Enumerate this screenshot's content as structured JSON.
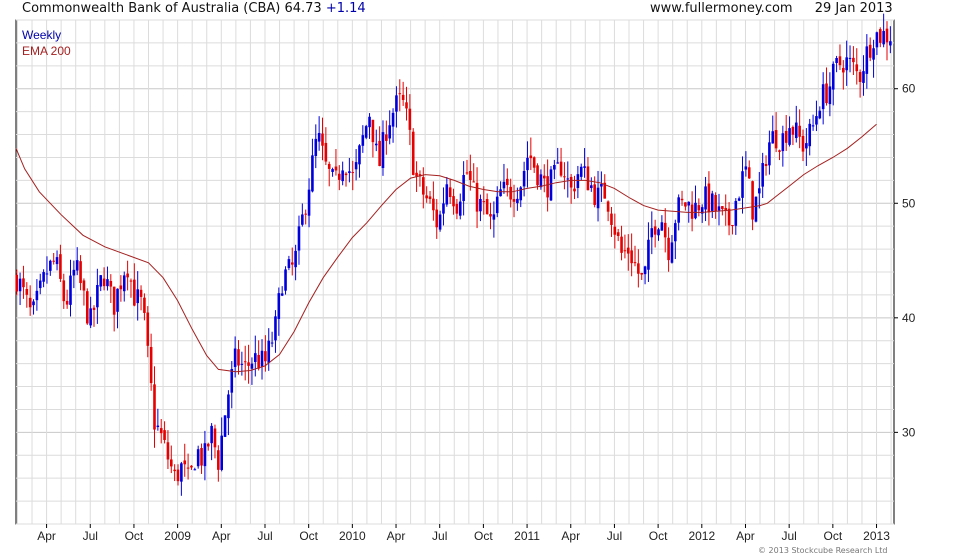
{
  "header": {
    "title": "Commonwealth Bank of Australia (CBA) 64.73",
    "change": "+1.14",
    "site": "www.fullermoney.com",
    "date": "29 Jan 2013"
  },
  "legend": {
    "weekly": "Weekly",
    "ema": "EMA 200"
  },
  "footer": "© 2013 Stockcube Research Ltd",
  "colors": {
    "up": "#0000dd",
    "down": "#e60000",
    "ema": "#a52020",
    "grid": "#dcdcdc",
    "axis": "#000000"
  },
  "chart_data": {
    "type": "candlestick",
    "interval": "Weekly",
    "y_axis_side": "right",
    "ylim": [
      22,
      66
    ],
    "ytick_labels": [
      "30",
      "40",
      "50",
      "60"
    ],
    "ytick_values": [
      30,
      40,
      50,
      60
    ],
    "xtick_labels": [
      "Apr",
      "Jul",
      "Oct",
      "2009",
      "Apr",
      "Jul",
      "Oct",
      "2010",
      "Apr",
      "Jul",
      "Oct",
      "2011",
      "Apr",
      "Jul",
      "Oct",
      "2012",
      "Apr",
      "Jul",
      "Oct",
      "2013"
    ],
    "xtick_months": [
      3,
      6,
      9,
      12,
      15,
      18,
      21,
      24,
      27,
      30,
      33,
      36,
      39,
      42,
      45,
      48,
      51,
      54,
      57,
      60
    ],
    "x_start_month": 0.9,
    "x_end_month": 61.2,
    "close_anchors": [
      [
        1.0,
        43.5
      ],
      [
        2.0,
        40.0
      ],
      [
        3.0,
        44.0
      ],
      [
        3.6,
        45.0
      ],
      [
        4.3,
        41.0
      ],
      [
        5.0,
        44.5
      ],
      [
        6.0,
        39.5
      ],
      [
        6.9,
        44.0
      ],
      [
        7.6,
        41.0
      ],
      [
        8.5,
        45.0
      ],
      [
        9.0,
        42.0
      ],
      [
        9.6,
        41.0
      ],
      [
        10.4,
        31.0
      ],
      [
        10.9,
        29.5
      ],
      [
        11.4,
        27.5
      ],
      [
        11.8,
        26.0
      ],
      [
        12.3,
        27.0
      ],
      [
        12.8,
        25.5
      ],
      [
        13.3,
        28.5
      ],
      [
        13.8,
        27.5
      ],
      [
        14.3,
        30.0
      ],
      [
        14.8,
        27.5
      ],
      [
        15.4,
        33.0
      ],
      [
        16.0,
        36.5
      ],
      [
        16.6,
        35.5
      ],
      [
        17.2,
        36.5
      ],
      [
        18.0,
        36.0
      ],
      [
        18.7,
        39.0
      ],
      [
        19.2,
        43.5
      ],
      [
        20.0,
        44.5
      ],
      [
        20.7,
        49.5
      ],
      [
        21.2,
        53.0
      ],
      [
        21.6,
        56.0
      ],
      [
        22.2,
        53.0
      ],
      [
        22.8,
        51.5
      ],
      [
        23.4,
        54.0
      ],
      [
        24.1,
        52.0
      ],
      [
        24.6,
        55.0
      ],
      [
        25.2,
        58.0
      ],
      [
        25.8,
        53.0
      ],
      [
        26.4,
        57.0
      ],
      [
        27.0,
        58.5
      ],
      [
        27.4,
        59.0
      ],
      [
        27.8,
        57.0
      ],
      [
        28.3,
        52.5
      ],
      [
        28.8,
        51.0
      ],
      [
        29.3,
        50.0
      ],
      [
        29.9,
        48.0
      ],
      [
        30.5,
        52.0
      ],
      [
        31.2,
        50.0
      ],
      [
        31.8,
        53.0
      ],
      [
        32.4,
        50.5
      ],
      [
        33.0,
        49.5
      ],
      [
        33.6,
        48.0
      ],
      [
        34.2,
        51.0
      ],
      [
        34.8,
        51.0
      ],
      [
        35.5,
        51.5
      ],
      [
        36.1,
        54.5
      ],
      [
        36.6,
        53.0
      ],
      [
        37.2,
        51.5
      ],
      [
        37.8,
        52.0
      ],
      [
        38.4,
        53.5
      ],
      [
        39.0,
        51.0
      ],
      [
        39.6,
        53.0
      ],
      [
        40.2,
        52.0
      ],
      [
        40.8,
        50.5
      ],
      [
        41.4,
        51.0
      ],
      [
        42.0,
        48.0
      ],
      [
        42.5,
        45.5
      ],
      [
        43.0,
        46.0
      ],
      [
        43.6,
        44.0
      ],
      [
        44.0,
        43.0
      ],
      [
        44.6,
        48.0
      ],
      [
        45.2,
        49.0
      ],
      [
        45.7,
        46.0
      ],
      [
        46.3,
        49.5
      ],
      [
        46.9,
        50.0
      ],
      [
        47.5,
        49.5
      ],
      [
        48.1,
        50.5
      ],
      [
        48.6,
        50.0
      ],
      [
        49.2,
        49.0
      ],
      [
        49.8,
        48.0
      ],
      [
        50.4,
        50.5
      ],
      [
        51.0,
        53.0
      ],
      [
        51.5,
        49.5
      ],
      [
        52.0,
        51.0
      ],
      [
        52.5,
        55.0
      ],
      [
        53.0,
        56.0
      ],
      [
        53.5,
        55.5
      ],
      [
        54.0,
        57.0
      ],
      [
        54.5,
        56.0
      ],
      [
        55.0,
        55.0
      ],
      [
        55.6,
        56.5
      ],
      [
        56.1,
        59.0
      ],
      [
        56.7,
        60.0
      ],
      [
        57.3,
        62.0
      ],
      [
        57.8,
        62.5
      ],
      [
        58.3,
        62.0
      ],
      [
        58.8,
        61.0
      ],
      [
        59.3,
        63.0
      ],
      [
        59.8,
        64.7
      ]
    ],
    "ema_200": [
      [
        0.9,
        54.8
      ],
      [
        1.5,
        53.0
      ],
      [
        2.5,
        51.0
      ],
      [
        4.0,
        49.0
      ],
      [
        5.5,
        47.2
      ],
      [
        7.0,
        46.2
      ],
      [
        8.5,
        45.5
      ],
      [
        10.0,
        44.8
      ],
      [
        11.0,
        43.5
      ],
      [
        12.0,
        41.5
      ],
      [
        13.0,
        39.0
      ],
      [
        14.0,
        36.7
      ],
      [
        14.8,
        35.5
      ],
      [
        16.0,
        35.3
      ],
      [
        17.0,
        35.4
      ],
      [
        18.0,
        35.8
      ],
      [
        19.0,
        36.8
      ],
      [
        20.0,
        38.8
      ],
      [
        21.0,
        41.3
      ],
      [
        22.0,
        43.5
      ],
      [
        23.0,
        45.3
      ],
      [
        24.0,
        47.0
      ],
      [
        25.0,
        48.3
      ],
      [
        26.0,
        49.8
      ],
      [
        27.0,
        51.2
      ],
      [
        28.0,
        52.2
      ],
      [
        29.0,
        52.5
      ],
      [
        30.0,
        52.4
      ],
      [
        31.0,
        52.0
      ],
      [
        32.0,
        51.5
      ],
      [
        33.0,
        51.2
      ],
      [
        34.0,
        51.0
      ],
      [
        35.0,
        51.0
      ],
      [
        36.0,
        51.3
      ],
      [
        37.0,
        51.5
      ],
      [
        38.0,
        51.8
      ],
      [
        39.0,
        52.0
      ],
      [
        40.0,
        52.0
      ],
      [
        41.0,
        51.8
      ],
      [
        42.0,
        51.3
      ],
      [
        43.0,
        50.5
      ],
      [
        44.0,
        49.8
      ],
      [
        45.0,
        49.4
      ],
      [
        46.0,
        49.3
      ],
      [
        47.0,
        49.2
      ],
      [
        48.0,
        49.2
      ],
      [
        49.0,
        49.3
      ],
      [
        50.0,
        49.4
      ],
      [
        51.0,
        49.6
      ],
      [
        52.0,
        49.8
      ],
      [
        52.5,
        50.0
      ],
      [
        53.0,
        50.5
      ],
      [
        54.0,
        51.5
      ],
      [
        55.0,
        52.5
      ],
      [
        56.0,
        53.3
      ],
      [
        57.0,
        54.0
      ],
      [
        58.0,
        54.8
      ],
      [
        59.0,
        55.8
      ],
      [
        60.0,
        56.9
      ]
    ]
  }
}
